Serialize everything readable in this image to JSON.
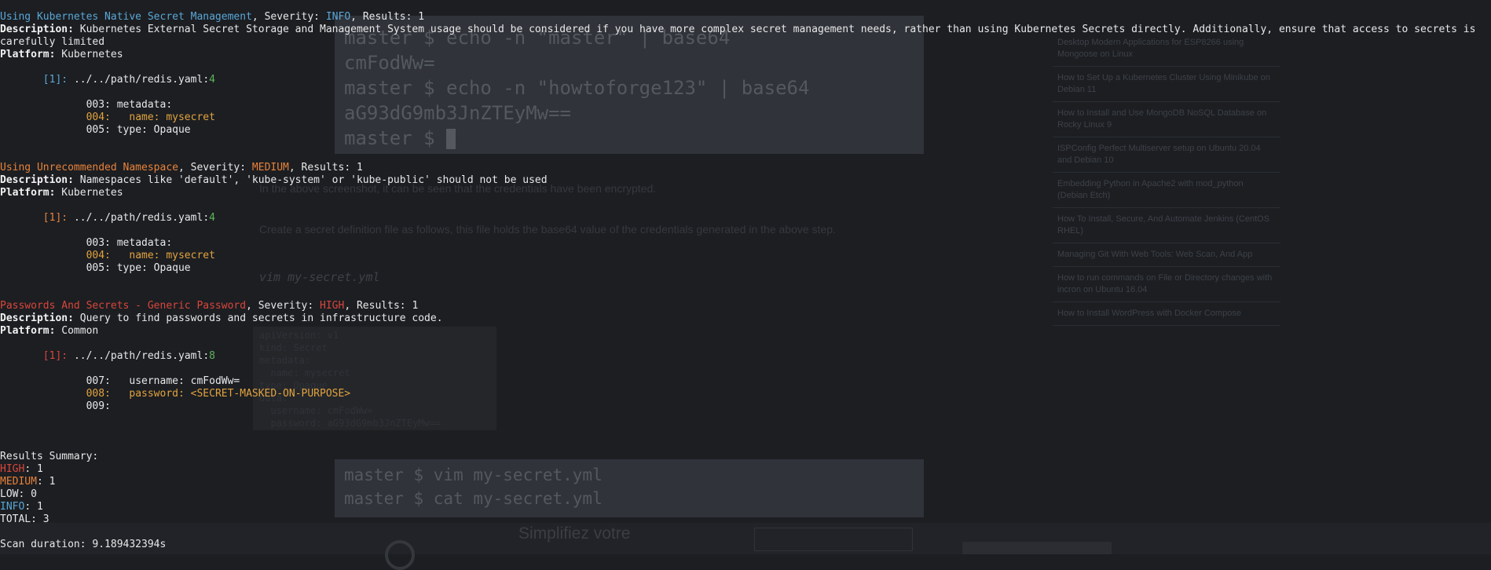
{
  "background": {
    "code_top": [
      "master $ echo -n \"master\" | base64",
      "cmFodWw=",
      "master $ echo -n \"howtoforge123\" | base64",
      "aG93dG9mb3JnZTEyMw==",
      "master $ "
    ],
    "para1": "In the above screenshot, it can be seen that the credentials have been encrypted.",
    "para2": "Create a secret definition file as follows, this file holds the base64 value of the credentials generated in the above step.",
    "command": "vim my-secret.yml",
    "yaml_lines": [
      "apiVersion: v1",
      "kind: Secret",
      "metadata:",
      "  name: mysecret",
      "type: Opaque",
      "data:",
      "  username: cmFodWw=",
      "  password: aG93dG9mb3JnZTEyMw=="
    ],
    "code_bottom": [
      "master $ vim my-secret.yml",
      "master $ cat my-secret.yml"
    ],
    "sidebar": [
      "Desktop Modern Applications for ESP8266 using Mongoose on Linux",
      "How to Set Up a Kubernetes Cluster Using Minikube on Debian 11",
      "How to Install and Use MongoDB NoSQL Database on Rocky Linux 9",
      "ISPConfig Perfect Multiserver setup on Ubuntu 20.04 and Debian 10",
      "Embedding Python in Apache2 with mod_python (Debian Etch)",
      "How To Install, Secure, And Automate Jenkins (CentOS RHEL)",
      "Managing Git With Web Tools: Web Scan, And App",
      "How to run commands on File or Directory changes with incron on Ubuntu 16.04",
      "How to Install WordPress with Docker Compose"
    ],
    "ad_title": "Simplifiez votre"
  },
  "terminal": {
    "findings": [
      {
        "name": "Using Kubernetes Native Secret Management",
        "severity": "INFO",
        "severity_color": "#5aa7d6",
        "results": "1",
        "description": "Kubernetes External Secret Storage and Management System usage should be considered if you have more complex secret management needs, rather than using Kubernetes Secrets directly. Additionally, ensure that access to secrets is carefully limited",
        "platform": "Kubernetes",
        "file": "../../path/redis.yaml",
        "line": "4",
        "code": [
          {
            "num": "003:",
            "text": " metadata:",
            "highlight": false
          },
          {
            "num": "004:",
            "text": "   name: mysecret",
            "highlight": true
          },
          {
            "num": "005:",
            "text": " type: Opaque",
            "highlight": false
          }
        ]
      },
      {
        "name": "Using Unrecommended Namespace",
        "severity": "MEDIUM",
        "severity_color": "#e8833a",
        "results": "1",
        "description": "Namespaces like 'default', 'kube-system' or 'kube-public' should not be used",
        "platform": "Kubernetes",
        "file": "../../path/redis.yaml",
        "line": "4",
        "code": [
          {
            "num": "003:",
            "text": " metadata:",
            "highlight": false
          },
          {
            "num": "004:",
            "text": "   name: mysecret",
            "highlight": true
          },
          {
            "num": "005:",
            "text": " type: Opaque",
            "highlight": false
          }
        ]
      },
      {
        "name": "Passwords And Secrets - Generic Password",
        "severity": "HIGH",
        "severity_color": "#d9463b",
        "results": "1",
        "description": "Query to find passwords and secrets in infrastructure code.",
        "platform": "Common",
        "file": "../../path/redis.yaml",
        "line": "8",
        "code": [
          {
            "num": "007:",
            "text": "   username: cmFodWw=",
            "highlight": false
          },
          {
            "num": "008:",
            "text": "   password: <SECRET-MASKED-ON-PURPOSE>",
            "highlight": true
          },
          {
            "num": "009:",
            "text": "",
            "highlight": false
          }
        ]
      }
    ],
    "labels": {
      "severity": "Severity: ",
      "results": "Results: ",
      "description": "Description:",
      "platform": "Platform:",
      "index": "[1]:"
    },
    "summary": {
      "title": "Results Summary:",
      "high": {
        "label": "HIGH",
        "value": "1"
      },
      "medium": {
        "label": "MEDIUM",
        "value": "1"
      },
      "low": {
        "label": "LOW",
        "value": "0"
      },
      "info": {
        "label": "INFO",
        "value": "1"
      },
      "total": {
        "label": "TOTAL",
        "value": "3"
      }
    },
    "scan_duration": "Scan duration: 9.189432394s"
  },
  "colors": {
    "info": "#5aa7d6",
    "medium": "#e8833a",
    "high": "#d9463b",
    "line_number": "#5fb45a",
    "highlight": "#e2a33f"
  }
}
